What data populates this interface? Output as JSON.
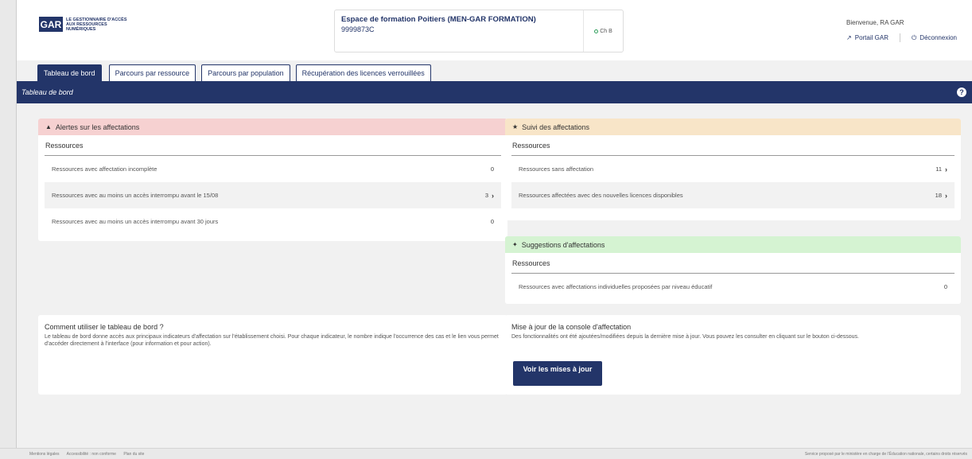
{
  "header": {
    "logo_abbr": "GAR",
    "logo_text": "LE GESTIONNAIRE D'ACCÈS AUX RESSOURCES NUMÉRIQUES",
    "establishment_name": "Espace de formation Poitiers (MEN-GAR FORMATION)",
    "establishment_code": "9999873C",
    "status_label": "Ch B",
    "welcome": "Bienvenue, RA GAR",
    "portail_link": "Portail GAR",
    "logout_link": "Déconnexion"
  },
  "tabs": [
    {
      "label": "Tableau de bord",
      "active": true
    },
    {
      "label": "Parcours par ressource",
      "active": false
    },
    {
      "label": "Parcours par population",
      "active": false
    },
    {
      "label": "Récupération des licences verrouillées",
      "active": false
    }
  ],
  "page_title": "Tableau de bord",
  "alertes": {
    "title": "Alertes sur les affectations",
    "subtitle": "Ressources",
    "rows": [
      {
        "label": "Ressources avec affectation incomplète",
        "count": "0"
      },
      {
        "label": "Ressources avec au moins un accès interrompu avant le 15/08",
        "count": "3"
      },
      {
        "label": "Ressources avec au moins un accès interrompu avant 30 jours",
        "count": "0"
      }
    ]
  },
  "suivi": {
    "title": "Suivi des affectations",
    "subtitle": "Ressources",
    "rows": [
      {
        "label": "Ressources sans affectation",
        "count": "11"
      },
      {
        "label": "Ressources affectées avec des nouvelles licences disponibles",
        "count": "18"
      }
    ]
  },
  "suggestions": {
    "title": "Suggestions d'affectations",
    "subtitle": "Ressources",
    "rows": [
      {
        "label": "Ressources avec affectations individuelles proposées par niveau éducatif",
        "count": "0"
      }
    ]
  },
  "howto": {
    "title": "Comment utiliser le tableau de bord ?",
    "text": "Le tableau de bord donne accès aux principaux indicateurs d'affectation sur l'établissement choisi. Pour chaque indicateur, le nombre indique l'occurrence des cas et le lien vous permet d'accéder directement à l'interface (pour information et pour action)."
  },
  "maj": {
    "title": "Mise à jour de la console d'affectation",
    "text": "Des fonctionnalités ont été ajoutées/modifiées depuis la dernière mise à jour. Vous pouvez les consulter en cliquant sur le bouton ci-dessous.",
    "button": "Voir les mises à jour"
  },
  "footer": {
    "mentions": "Mentions légales",
    "accessibilite": "Accessibilité : non conforme",
    "plan": "Plan du site",
    "service": "Service proposé par le ministère en charge de l'Éducation nationale, certains droits réservés"
  },
  "colors": {
    "brand": "#233569",
    "alert_bg": "#f6d1d1",
    "suivi_bg": "#f8e5c8",
    "suggest_bg": "#d5f3d2"
  }
}
